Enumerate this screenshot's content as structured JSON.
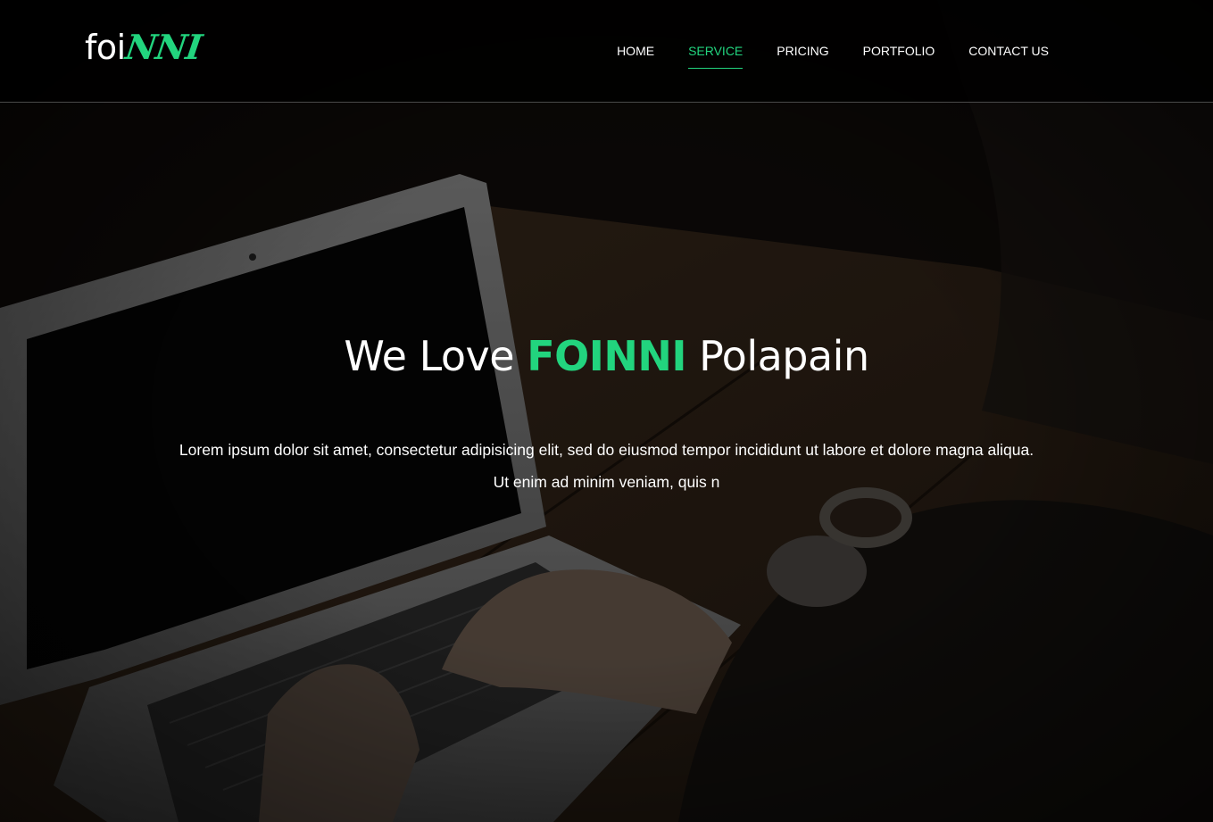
{
  "brand": {
    "logo_main": "foi",
    "logo_accent": "NNI",
    "accent_color": "#22d47e"
  },
  "nav": {
    "items": [
      {
        "label": "HOME",
        "active": false
      },
      {
        "label": "SERVICE",
        "active": true
      },
      {
        "label": "PRICING",
        "active": false
      },
      {
        "label": "PORTFOLIO",
        "active": false
      },
      {
        "label": "CONTACT US",
        "active": false
      }
    ]
  },
  "hero": {
    "title_prefix": "We Love",
    "title_brand": "FOINNI",
    "title_suffix": "Polapain",
    "text_line1": "Lorem ipsum dolor sit amet, consectetur adipisicing elit, sed do eiusmod tempor incididunt ut labore et dolore magna aliqua.",
    "text_line2": "Ut enim ad minim veniam, quis n",
    "background_image": "laptop-on-desk-photo"
  }
}
